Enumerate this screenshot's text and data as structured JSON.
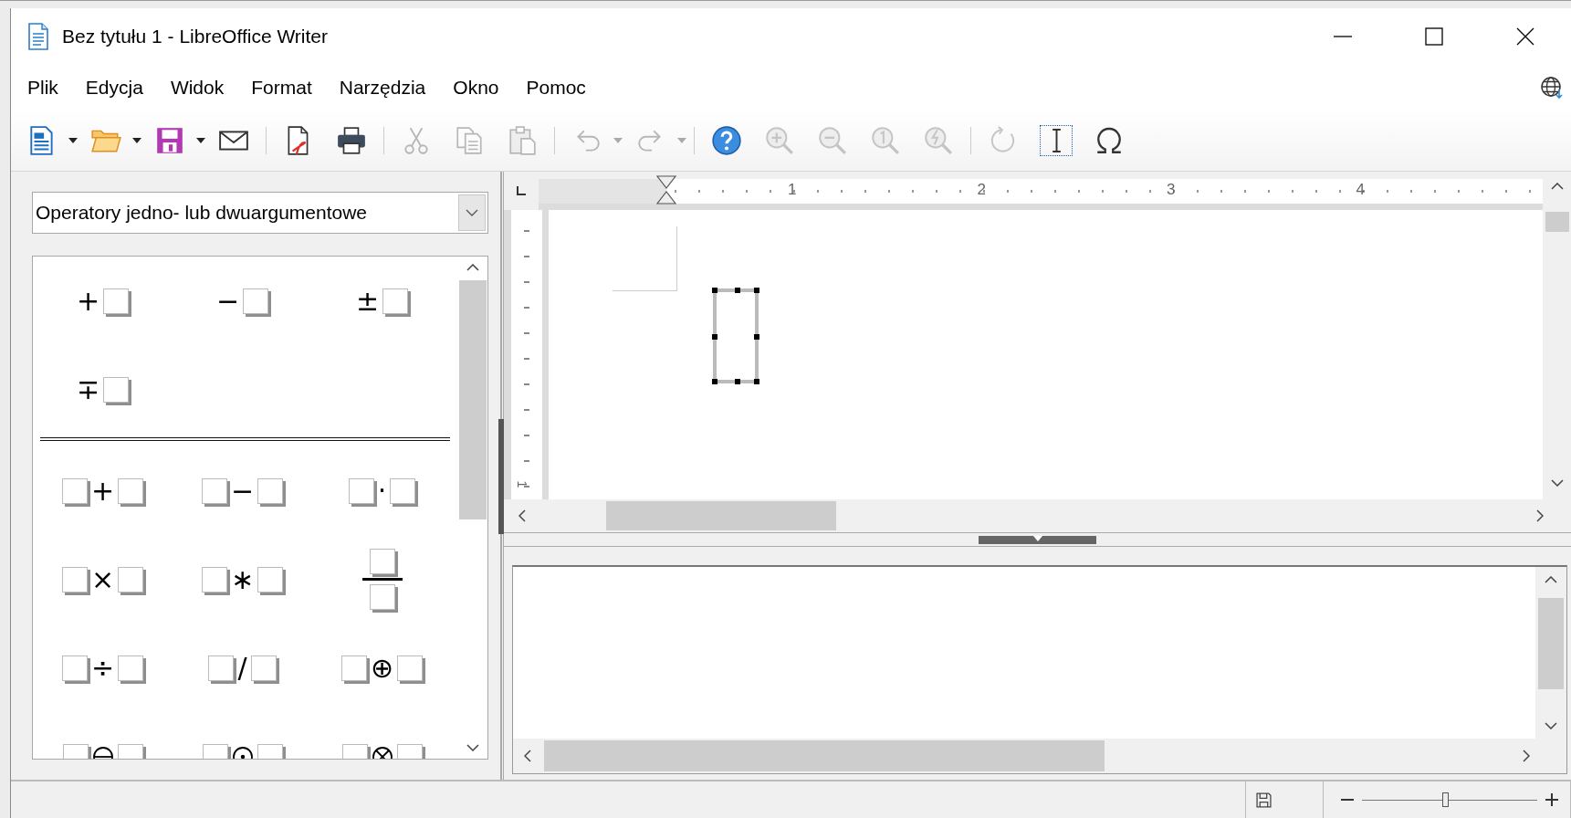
{
  "window": {
    "title": "Bez tytułu 1 - LibreOffice Writer"
  },
  "menu": [
    "Plik",
    "Edycja",
    "Widok",
    "Format",
    "Narzędzia",
    "Okno",
    "Pomoc"
  ],
  "toolbar": [
    [
      {
        "kind": "new-document",
        "dropdown": true,
        "disabled": false,
        "on": false
      },
      {
        "kind": "open",
        "dropdown": true,
        "disabled": false,
        "on": false
      },
      {
        "kind": "save",
        "dropdown": true,
        "disabled": false,
        "on": false
      },
      {
        "kind": "mail",
        "dropdown": false,
        "disabled": false,
        "on": false
      }
    ],
    [
      {
        "kind": "pdf",
        "dropdown": false,
        "disabled": false,
        "on": false
      },
      {
        "kind": "print",
        "dropdown": false,
        "disabled": false,
        "on": false
      }
    ],
    [
      {
        "kind": "cut",
        "dropdown": false,
        "disabled": true,
        "on": false
      },
      {
        "kind": "copy",
        "dropdown": false,
        "disabled": true,
        "on": false
      },
      {
        "kind": "paste",
        "dropdown": false,
        "disabled": true,
        "on": false
      }
    ],
    [
      {
        "kind": "undo",
        "dropdown": true,
        "disabled": true,
        "on": false
      },
      {
        "kind": "redo",
        "dropdown": true,
        "disabled": true,
        "on": false
      }
    ],
    [
      {
        "kind": "help",
        "dropdown": false,
        "disabled": false,
        "on": false
      },
      {
        "kind": "zoom-in",
        "dropdown": false,
        "disabled": true,
        "on": false
      },
      {
        "kind": "zoom-out",
        "dropdown": false,
        "disabled": true,
        "on": false
      },
      {
        "kind": "zoom-100",
        "dropdown": false,
        "disabled": true,
        "on": false
      },
      {
        "kind": "zoom-page",
        "dropdown": false,
        "disabled": true,
        "on": false
      }
    ],
    [
      {
        "kind": "update",
        "dropdown": false,
        "disabled": true,
        "on": false
      },
      {
        "kind": "formula-cursor",
        "dropdown": false,
        "disabled": false,
        "on": true
      },
      {
        "kind": "omega",
        "dropdown": false,
        "disabled": false,
        "on": false
      }
    ]
  ],
  "elements": {
    "category": "Operatory jedno- lub dwuargumentowe",
    "groups": [
      [
        {
          "kind": "prefix",
          "symbol": "+"
        },
        {
          "kind": "prefix",
          "symbol": "−"
        },
        {
          "kind": "prefix",
          "symbol": "±"
        },
        {
          "kind": "prefix",
          "symbol": "∓"
        }
      ],
      [
        {
          "kind": "binary",
          "symbol": "+"
        },
        {
          "kind": "binary",
          "symbol": "−"
        },
        {
          "kind": "binary",
          "symbol": "·"
        },
        {
          "kind": "binary",
          "symbol": "×"
        },
        {
          "kind": "binary",
          "symbol": "∗"
        },
        {
          "kind": "fraction"
        },
        {
          "kind": "binary",
          "symbol": "÷"
        },
        {
          "kind": "binary",
          "symbol": "/"
        },
        {
          "kind": "binary",
          "symbol": "⊕"
        },
        {
          "kind": "circle-minus"
        },
        {
          "kind": "circle-dot"
        },
        {
          "kind": "circle-times"
        }
      ]
    ]
  },
  "ruler": {
    "labels": [
      "1",
      "2",
      "3",
      "4"
    ]
  },
  "vertical_ruler": {
    "labels": [
      "1"
    ]
  },
  "status_bar": {
    "zoom": {
      "level": 0.48
    }
  }
}
